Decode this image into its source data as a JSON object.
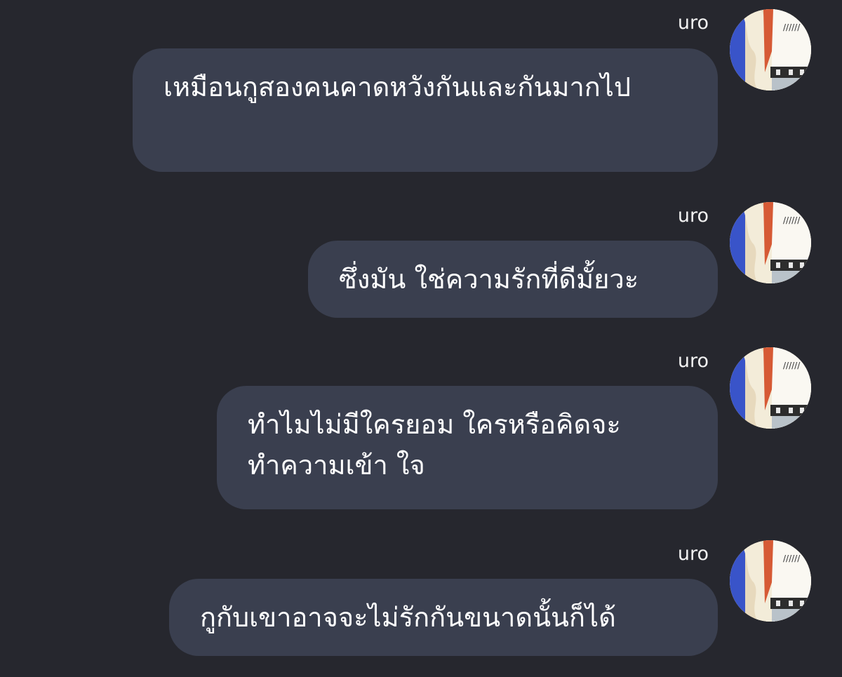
{
  "messages": [
    {
      "sender": "uro",
      "text": "เหมือนกูสองคนคาดหวังกันและกันมากไป"
    },
    {
      "sender": "uro",
      "text": "ซึ่งมัน ใช่ความรักที่ดีมั้ยวะ"
    },
    {
      "sender": "uro",
      "text": "ทำไมไม่มีใครยอม ใครหรือคิดจะทำความเข้า ใจ"
    },
    {
      "sender": "uro",
      "text": "กูกับเขาอาจจะไม่รักกันขนาดนั้นก็ได้"
    }
  ],
  "colors": {
    "background": "#26272e",
    "bubble": "#3a3f4f",
    "text": "#ffffff"
  },
  "icons": {
    "avatar": "user-avatar-icon"
  }
}
